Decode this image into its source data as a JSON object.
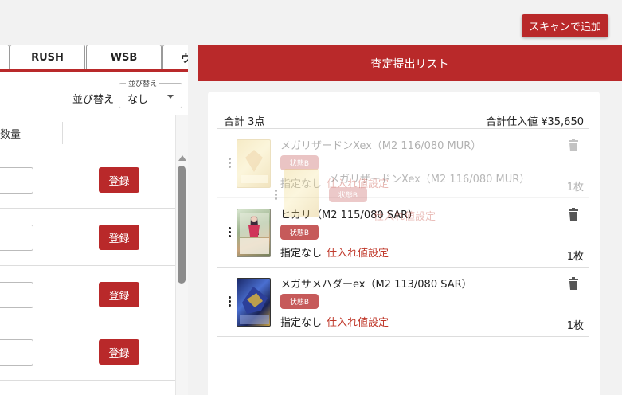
{
  "scan_button": "スキャンで追加",
  "left": {
    "tabs": [
      "RUSH",
      "WSB",
      "ウ"
    ],
    "sort_label": "並び替え",
    "sort_legend": "並び替え",
    "sort_value": "なし",
    "col_qty": "数量",
    "register_label": "登録",
    "rows": 4
  },
  "right": {
    "header": "査定提出リスト",
    "count": "合計 3点",
    "total": "合計仕入値 ¥35,650",
    "items": [
      {
        "name": "メガリザードンXex（M2 116/080 MUR）",
        "badge": "状態B",
        "unspec": "指定なし",
        "price_link": "仕入れ値設定",
        "qty": "1枚"
      },
      {
        "name": "ヒカリ（M2 115/080 SAR）",
        "badge": "状態B",
        "unspec": "指定なし",
        "price_link": "仕入れ値設定",
        "qty": "1枚"
      },
      {
        "name": "メガサメハダーex（M2 113/080 SAR）",
        "badge": "状態B",
        "unspec": "指定なし",
        "price_link": "仕入れ値設定",
        "qty": "1枚"
      }
    ]
  },
  "colors": {
    "accent": "#b9292a",
    "link": "#c0392b",
    "badge": "#c65a5a"
  }
}
